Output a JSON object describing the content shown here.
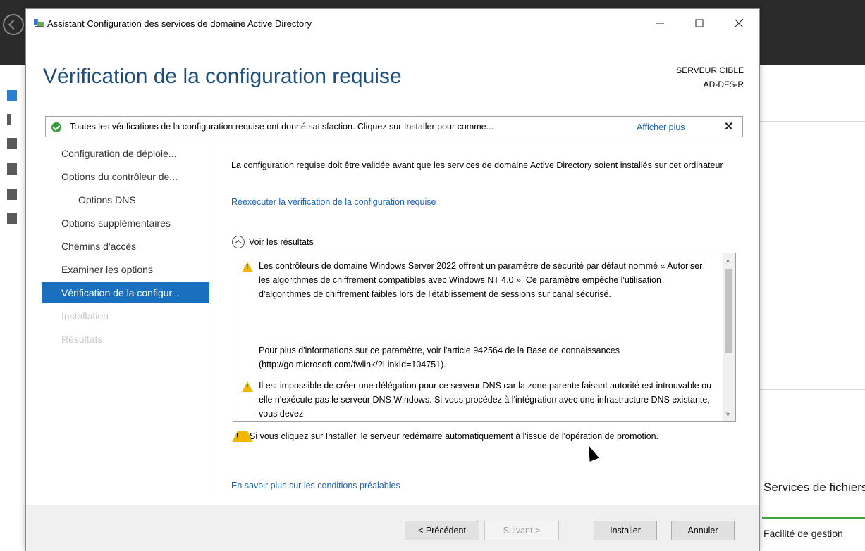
{
  "background": {
    "tile_title": "Services de fichiers et de stockage",
    "tile_subtitle": "Facilité de gestion"
  },
  "dialog": {
    "title": "Assistant Configuration des services de domaine Active Directory",
    "page_title": "Vérification de la configuration requise",
    "target_label": "SERVEUR CIBLE",
    "target_name": "AD-DFS-R",
    "banner": {
      "text": "Toutes les vérifications de la configuration requise ont donné satisfaction. Cliquez sur Installer pour comme...",
      "link": "Afficher plus",
      "close": "✕"
    },
    "nav": [
      {
        "label": "Configuration de déploie...",
        "state": "normal"
      },
      {
        "label": "Options du contrôleur de...",
        "state": "normal"
      },
      {
        "label": "Options DNS",
        "state": "sub"
      },
      {
        "label": "Options supplémentaires",
        "state": "normal"
      },
      {
        "label": "Chemins d'accès",
        "state": "normal"
      },
      {
        "label": "Examiner les options",
        "state": "normal"
      },
      {
        "label": "Vérification de la configur...",
        "state": "active"
      },
      {
        "label": "Installation",
        "state": "disabled"
      },
      {
        "label": "Résultats",
        "state": "disabled"
      }
    ],
    "intro": "La configuration requise doit être validée avant que les services de domaine Active Directory soient installés sur cet ordinateur",
    "rerun_link": "Réexécuter la vérification de la configuration requise",
    "results_label": "Voir les résultats",
    "results": [
      "Les contrôleurs de domaine Windows Server 2022 offrent un paramètre de sécurité par défaut nommé « Autoriser les algorithmes de chiffrement compatibles avec Windows NT 4.0 ». Ce paramètre empêche l'utilisation d'algorithmes de chiffrement faibles lors de l'établissement de sessions sur canal sécurisé.",
      "Pour plus d'informations sur ce paramètre, voir l'article 942564 de la Base de connaissances (http://go.microsoft.com/fwlink/?LinkId=104751).",
      "Il est impossible de créer une délégation pour ce serveur DNS car la zone parente faisant autorité est introuvable ou elle n'exécute pas le serveur DNS Windows. Si vous procédez à l'intégration avec une infrastructure DNS existante, vous devez"
    ],
    "reboot_warning": "Si vous cliquez sur Installer, le serveur redémarre automatiquement à l'issue de l'opération de promotion.",
    "learn_link": "En savoir plus sur les conditions préalables",
    "buttons": {
      "prev": "< Précédent",
      "next": "Suivant >",
      "install": "Installer",
      "cancel": "Annuler"
    }
  },
  "colors": {
    "title_blue": "#1e4e79",
    "link_blue": "#1a63b5",
    "nav_active": "#1a6fbf",
    "success_green": "#3c9c3c",
    "warning_yellow": "#f2b705"
  }
}
